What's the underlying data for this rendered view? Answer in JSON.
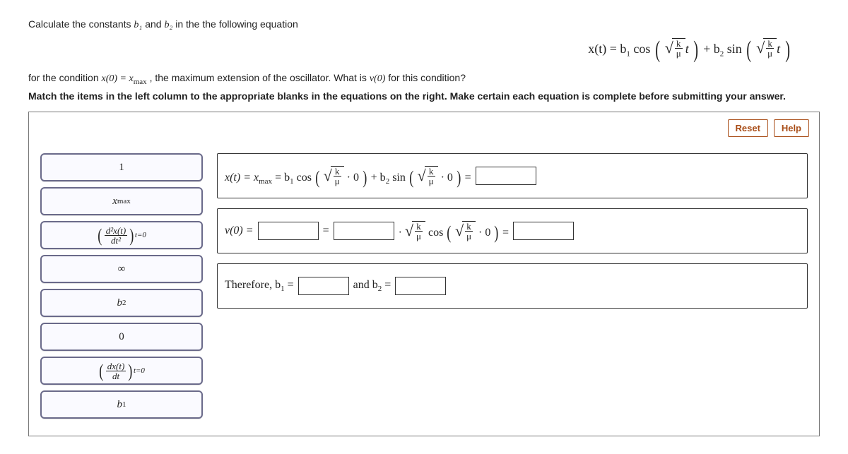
{
  "prompt": {
    "line1_a": "Calculate the constants ",
    "line1_b": " and ",
    "line1_c": " in the the following equation",
    "b1": "b₁",
    "b2": "b₂",
    "line2_a": "for the condition ",
    "cond": "x(0) = x",
    "cond_sub": "max",
    "line2_b": ", the maximum extension of the oscillator. What is ",
    "v0": "v(0)",
    "line2_c": " for this condition?",
    "line3": "Match the items in the left column to the appropriate blanks in the equations on the right. Make certain each equation is complete before submitting your answer."
  },
  "main_eq": {
    "lhs": "x(t) = b",
    "s1": "1",
    "cos": " cos",
    "k": "k",
    "mu": "μ",
    "t": "t",
    "plus": " + b",
    "s2": "2",
    "sin": " sin"
  },
  "buttons": {
    "reset": "Reset",
    "help": "Help"
  },
  "tiles": {
    "t1": "1",
    "t2": "x",
    "t2_sub": "max",
    "t3a": "d²x(t)",
    "t3b": "dt²",
    "t3c": "t=0",
    "t4": "∞",
    "t5": "b",
    "t5_sub": "2",
    "t6": "0",
    "t7a": "dx(t)",
    "t7b": "dt",
    "t7c": "t=0",
    "t8": "b",
    "t8_sub": "1"
  },
  "rows": {
    "r1": {
      "pre": "x(t) = x",
      "pre_sub": "max",
      "eq": " = b",
      "s1": "1",
      "cos": " cos",
      "k": "k",
      "mu": "μ",
      "dot0": "· 0",
      "plus": " + b",
      "s2": "2",
      "sin": " sin",
      "eqs": " = "
    },
    "r2": {
      "pre": "v(0) = ",
      "eq": " = ",
      "dot": " · ",
      "k": "k",
      "mu": "μ",
      "cos": " cos",
      "dot0": "· 0",
      "eqs": " = "
    },
    "r3": {
      "pre": "Therefore, b",
      "s1": "1",
      "eq1": " = ",
      "mid": " and b",
      "s2": "2",
      "eq2": " = "
    }
  }
}
